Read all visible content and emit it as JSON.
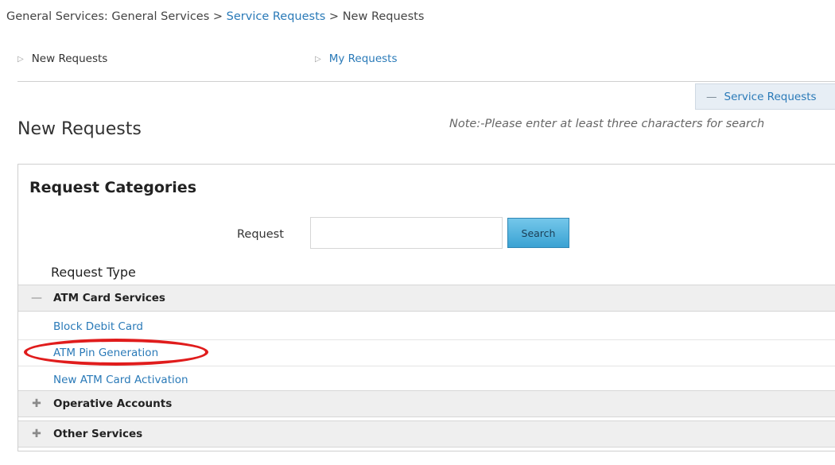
{
  "window_cut_text": "",
  "breadcrumb": {
    "part1": "General Services: General Services",
    "sep1": " > ",
    "part2": "Service Requests",
    "sep2": " > ",
    "part3": "New Requests"
  },
  "tabs": {
    "new_requests": "New Requests",
    "my_requests": "My Requests",
    "arrow_icon": "triangle-right-icon"
  },
  "service_requests_toggle": {
    "label": "Service Requests",
    "icon": "minus-icon"
  },
  "page": {
    "title": "New Requests",
    "note": "Note:-Please enter at least three characters for search"
  },
  "categories": {
    "title": "Request Categories",
    "search_label": "Request",
    "search_value": "",
    "search_button": "Search",
    "column_header": "Request Type",
    "groups": [
      {
        "name": "ATM Card Services",
        "state": "expanded",
        "items": [
          "Block Debit Card",
          "ATM Pin Generation",
          "New ATM Card Activation"
        ]
      },
      {
        "name": "Operative Accounts",
        "state": "collapsed",
        "items": []
      },
      {
        "name": "Other Services",
        "state": "collapsed",
        "items": []
      }
    ]
  },
  "colors": {
    "link": "#2a7ab8",
    "highlight_ellipse": "#e01c1c",
    "search_button": "#3aa2d3",
    "group_row_bg": "#efefef",
    "toggle_bg": "#e7eef5"
  }
}
